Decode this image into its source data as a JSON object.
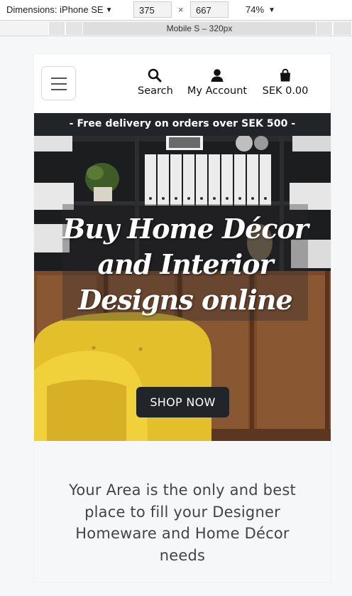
{
  "devtools": {
    "device": "Dimensions: iPhone SE",
    "width": "375",
    "height": "667",
    "separator": "×",
    "zoom": "74%",
    "media_query_label": "Mobile S – 320px"
  },
  "header": {
    "nav": [
      {
        "label": "Search",
        "icon": "search-icon"
      },
      {
        "label": "My Account",
        "icon": "user-icon"
      },
      {
        "label": "SEK 0.00",
        "icon": "shopping-bag-icon"
      }
    ]
  },
  "promo": {
    "text": "- Free delivery on orders over SEK 500 -"
  },
  "hero": {
    "title": "Buy Home Décor and Interior Designs online",
    "cta_label": "SHOP NOW"
  },
  "tagline": {
    "text": "Your Area is the only and best place to fill your Designer Homeware and Home Décor needs"
  },
  "colors": {
    "dark": "#212428",
    "accent_yellow": "#e8c42f",
    "tagline_bg": "#f6f7f9"
  }
}
